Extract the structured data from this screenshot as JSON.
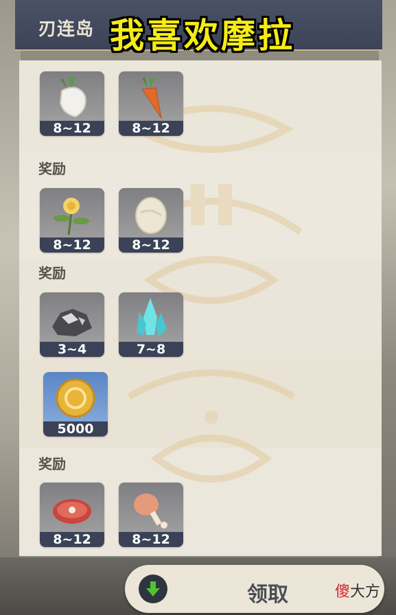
{
  "header": {
    "title": "刃连岛"
  },
  "overlay_caption": "我喜欢摩拉",
  "sections": [
    {
      "label": "",
      "items": [
        {
          "icon": "radish-icon",
          "qty": "8~12"
        },
        {
          "icon": "carrot-icon",
          "qty": "8~12"
        }
      ]
    },
    {
      "label": "奖励",
      "items": [
        {
          "icon": "sweet-flower-icon",
          "qty": "8~12"
        },
        {
          "icon": "bird-egg-icon",
          "qty": "8~12"
        }
      ]
    },
    {
      "label": "奖励",
      "items": [
        {
          "icon": "iron-chunk-icon",
          "qty": "3~4"
        },
        {
          "icon": "crystal-chunk-icon",
          "qty": "7~8"
        }
      ]
    },
    {
      "label": "",
      "items": [
        {
          "icon": "mora-coin-icon",
          "qty": "5000"
        }
      ]
    },
    {
      "label": "奖励",
      "items": [
        {
          "icon": "raw-meat-icon",
          "qty": "8~12"
        },
        {
          "icon": "fowl-drumstick-icon",
          "qty": "8~12"
        }
      ]
    }
  ],
  "claim_button": {
    "label": "领取",
    "icon": "download-arrow-icon"
  },
  "brand": {
    "part_a": "傻",
    "part_b": "大方"
  },
  "colors": {
    "accent_gold": "#f5ec14",
    "quantity_bar": "#3b4257",
    "header": "#4a5166",
    "panel": "#ece7dc"
  }
}
